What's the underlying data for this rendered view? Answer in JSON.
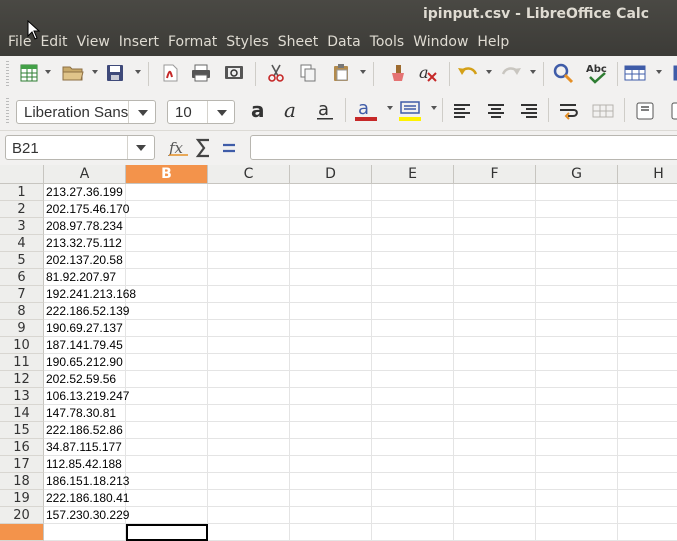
{
  "window": {
    "title": "ipinput.csv - LibreOffice Calc"
  },
  "menu": [
    "File",
    "Edit",
    "View",
    "Insert",
    "Format",
    "Styles",
    "Sheet",
    "Data",
    "Tools",
    "Window",
    "Help"
  ],
  "toolbar_standard": [
    "new-spreadsheet-icon",
    "open-folder-icon",
    "save-icon",
    "export-pdf-icon",
    "print-icon",
    "print-preview-icon",
    "cut-icon",
    "copy-icon",
    "paste-icon",
    "clone-formatting-icon",
    "clear-formatting-icon",
    "undo-icon",
    "redo-icon",
    "find-replace-icon",
    "spellcheck-icon",
    "row-icon"
  ],
  "font": {
    "name": "Liberation Sans",
    "size": "10"
  },
  "formula_bar": {
    "cell_ref": "B21",
    "formula": ""
  },
  "columns": [
    "A",
    "B",
    "C",
    "D",
    "E",
    "F",
    "G",
    "H"
  ],
  "selected_column": "B",
  "rows": [
    {
      "n": "1",
      "a": "213.27.36.199"
    },
    {
      "n": "2",
      "a": "202.175.46.170"
    },
    {
      "n": "3",
      "a": "208.97.78.234"
    },
    {
      "n": "4",
      "a": "213.32.75.112"
    },
    {
      "n": "5",
      "a": "202.137.20.58"
    },
    {
      "n": "6",
      "a": "81.92.207.97"
    },
    {
      "n": "7",
      "a": "192.241.213.168"
    },
    {
      "n": "8",
      "a": "222.186.52.139"
    },
    {
      "n": "9",
      "a": "190.69.27.137"
    },
    {
      "n": "10",
      "a": "187.141.79.45"
    },
    {
      "n": "11",
      "a": "190.65.212.90"
    },
    {
      "n": "12",
      "a": "202.52.59.56"
    },
    {
      "n": "13",
      "a": "106.13.219.247"
    },
    {
      "n": "14",
      "a": "147.78.30.81"
    },
    {
      "n": "15",
      "a": "222.186.52.86"
    },
    {
      "n": "16",
      "a": "34.87.115.177"
    },
    {
      "n": "17",
      "a": "112.85.42.188"
    },
    {
      "n": "18",
      "a": "186.151.18.213"
    },
    {
      "n": "19",
      "a": "222.186.180.41"
    },
    {
      "n": "20",
      "a": "157.230.30.229"
    }
  ],
  "colors": {
    "selection_header": "#f3934b",
    "title_bar": "#3c3b37"
  }
}
